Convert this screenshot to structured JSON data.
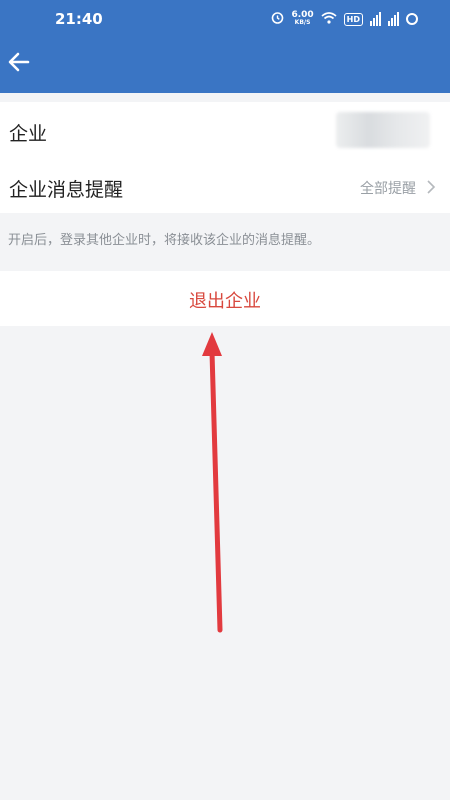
{
  "status_bar": {
    "time": "21:40",
    "speed_value": "6.00",
    "speed_unit": "KB/S",
    "hd_badge": "HD"
  },
  "header": {
    "back_icon": "arrow-left-icon",
    "background_color": "#3a75c4"
  },
  "settings": {
    "company_label": "企业",
    "company_name_redacted": true,
    "reminder_label": "企业消息提醒",
    "reminder_value": "全部提醒",
    "hint_text": "开启后，登录其他企业时，将接收该企业的消息提醒。"
  },
  "actions": {
    "exit_label": "退出企业",
    "exit_color": "#d8483e"
  },
  "annotation": {
    "type": "red-arrow-pointing-up",
    "color": "#e23a3f"
  }
}
